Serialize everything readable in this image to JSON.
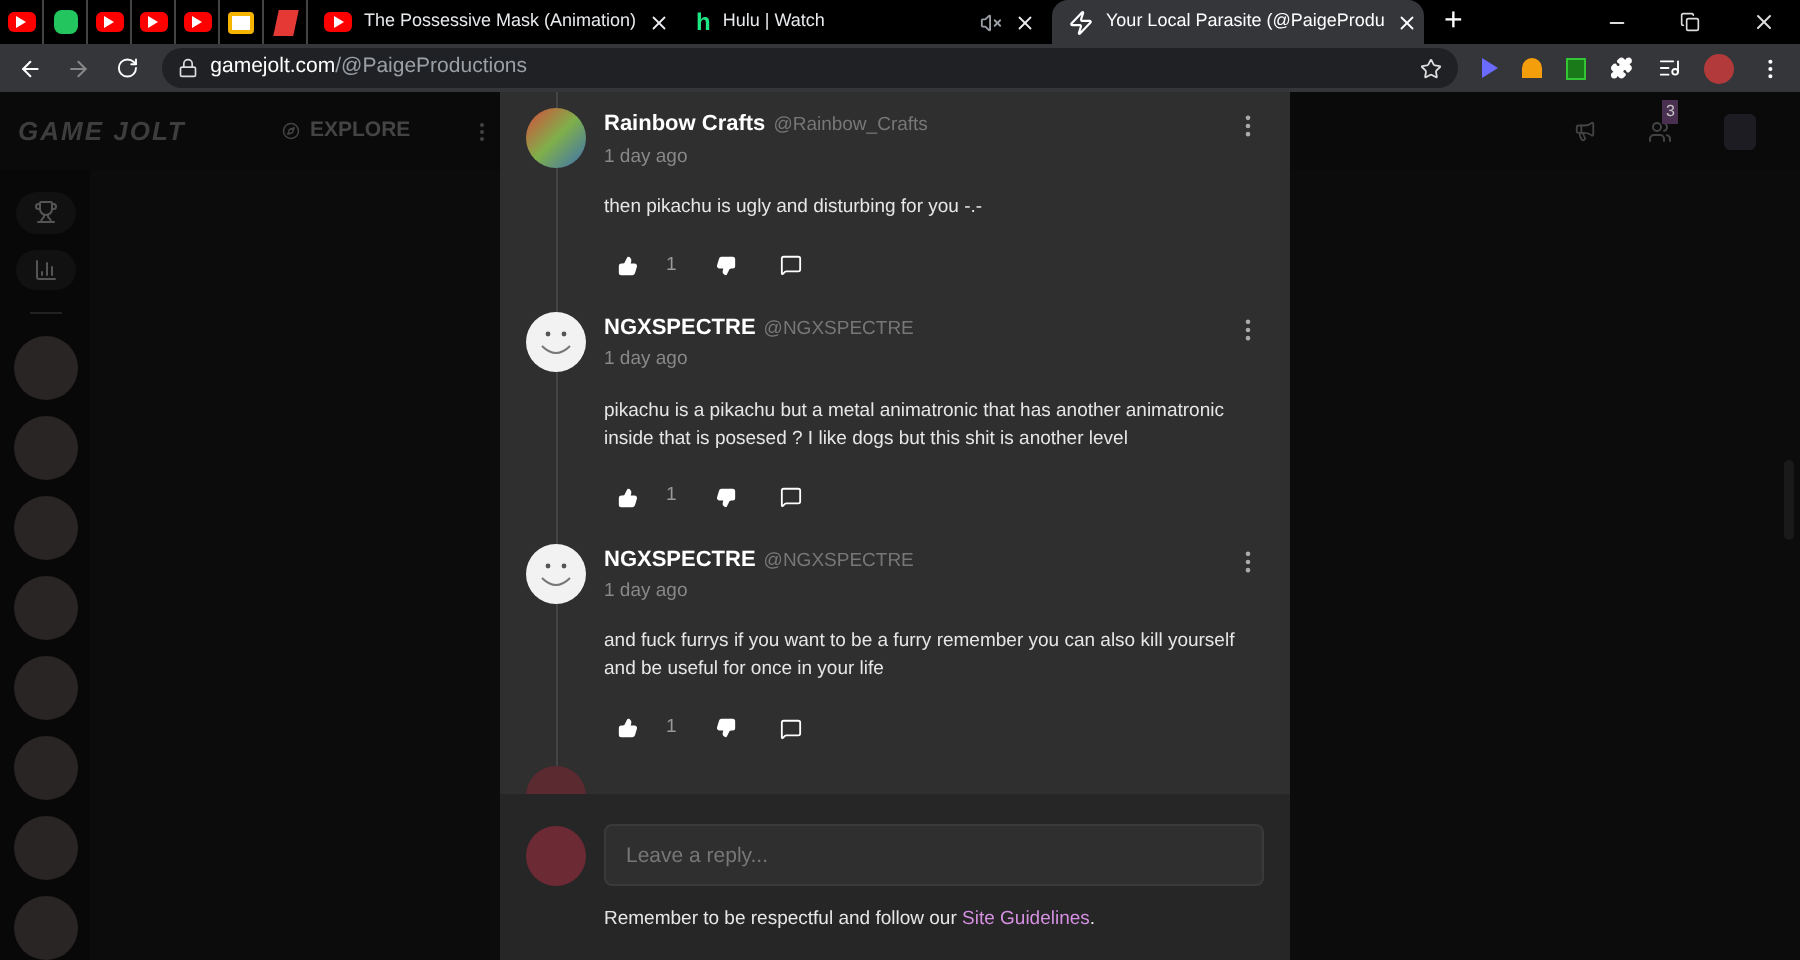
{
  "browser": {
    "tabs": [
      {
        "kind": "youtube",
        "selected": false
      },
      {
        "kind": "leaf",
        "selected": false
      },
      {
        "kind": "youtube",
        "selected": false
      },
      {
        "kind": "youtube",
        "selected": false
      },
      {
        "kind": "youtube",
        "selected": false
      },
      {
        "kind": "slides",
        "selected": false
      },
      {
        "kind": "reddoc",
        "selected": false
      },
      {
        "kind": "youtube",
        "title": "The Possessive Mask (Animation)",
        "closable": true,
        "selected": false
      },
      {
        "kind": "hulu",
        "icon_text": "h",
        "title": "Hulu | Watch",
        "muted": true,
        "closable": true,
        "selected": false
      },
      {
        "kind": "bolt",
        "title": "Your Local Parasite (@PaigeProdu",
        "closable": true,
        "selected": true
      }
    ],
    "new_tab": "+",
    "url_host": "gamejolt.com",
    "url_path": "/@PaigeProductions"
  },
  "site_header": {
    "logo": "GAME JOLT",
    "explore": "EXPLORE",
    "friend_requests": "3"
  },
  "comments": [
    {
      "author": "Rainbow Crafts",
      "handle": "@Rainbow_Crafts",
      "time": "1 day ago",
      "body": "then pikachu is ugly and disturbing for you -.-",
      "likes": "1",
      "kind": "art"
    },
    {
      "author": "NGXSPECTRE",
      "handle": "@NGXSPECTRE",
      "time": "1 day ago",
      "body": "pikachu is a pikachu but a metal animatronic that has another  animatronic inside that is posesed ? I like dogs but this shit is another level",
      "likes": "1",
      "kind": "smiley"
    },
    {
      "author": "NGXSPECTRE",
      "handle": "@NGXSPECTRE",
      "time": "1 day ago",
      "body": "and fuck furrys if you want to be a furry remember you can also kill yourself and be useful for once in your life",
      "likes": "1",
      "kind": "smiley"
    }
  ],
  "composer": {
    "placeholder": "Leave a reply...",
    "note": "Remember to be respectful and follow our",
    "link": "Site Guidelines",
    "note_end": "."
  }
}
